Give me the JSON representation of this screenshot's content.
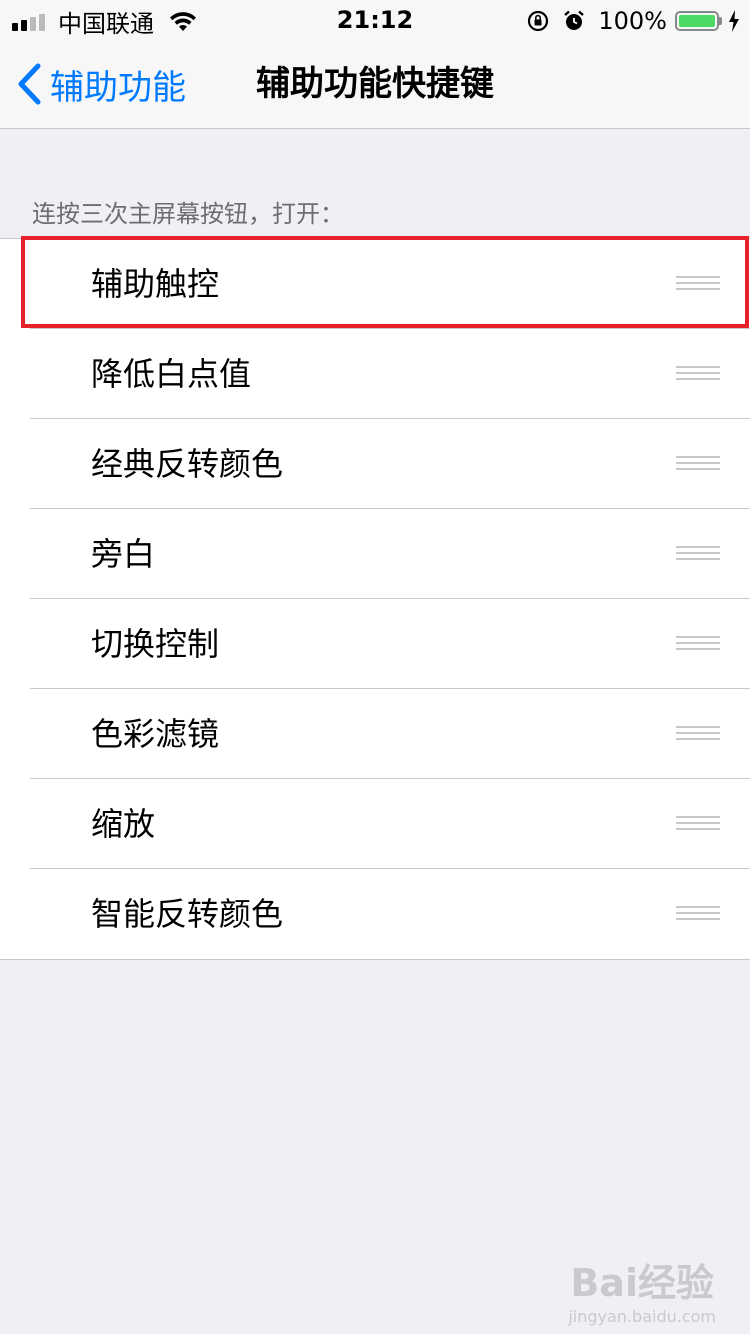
{
  "status_bar": {
    "carrier": "中国联通",
    "time": "21:12",
    "battery_percent": "100%",
    "battery_level": 1.0,
    "signal_bars_filled": 2,
    "icons": [
      "signal-icon",
      "wifi-icon",
      "orientation-lock-icon",
      "alarm-icon",
      "battery-icon",
      "charging-bolt-icon"
    ]
  },
  "nav": {
    "back_label": "辅助功能",
    "title": "辅助功能快捷键"
  },
  "section": {
    "header": "连按三次主屏幕按钮，打开："
  },
  "items": [
    {
      "label": "辅助触控"
    },
    {
      "label": "降低白点值"
    },
    {
      "label": "经典反转颜色"
    },
    {
      "label": "旁白"
    },
    {
      "label": "切换控制"
    },
    {
      "label": "色彩滤镜"
    },
    {
      "label": "缩放"
    },
    {
      "label": "智能反转颜色"
    }
  ],
  "highlighted_item": "辅助触控",
  "colors": {
    "accent": "#007aff",
    "highlight": "#e8202a",
    "battery": "#4cd964",
    "background": "#efeff4"
  },
  "watermark": {
    "brand": "Bai经验",
    "url": "jingyan.baidu.com"
  }
}
